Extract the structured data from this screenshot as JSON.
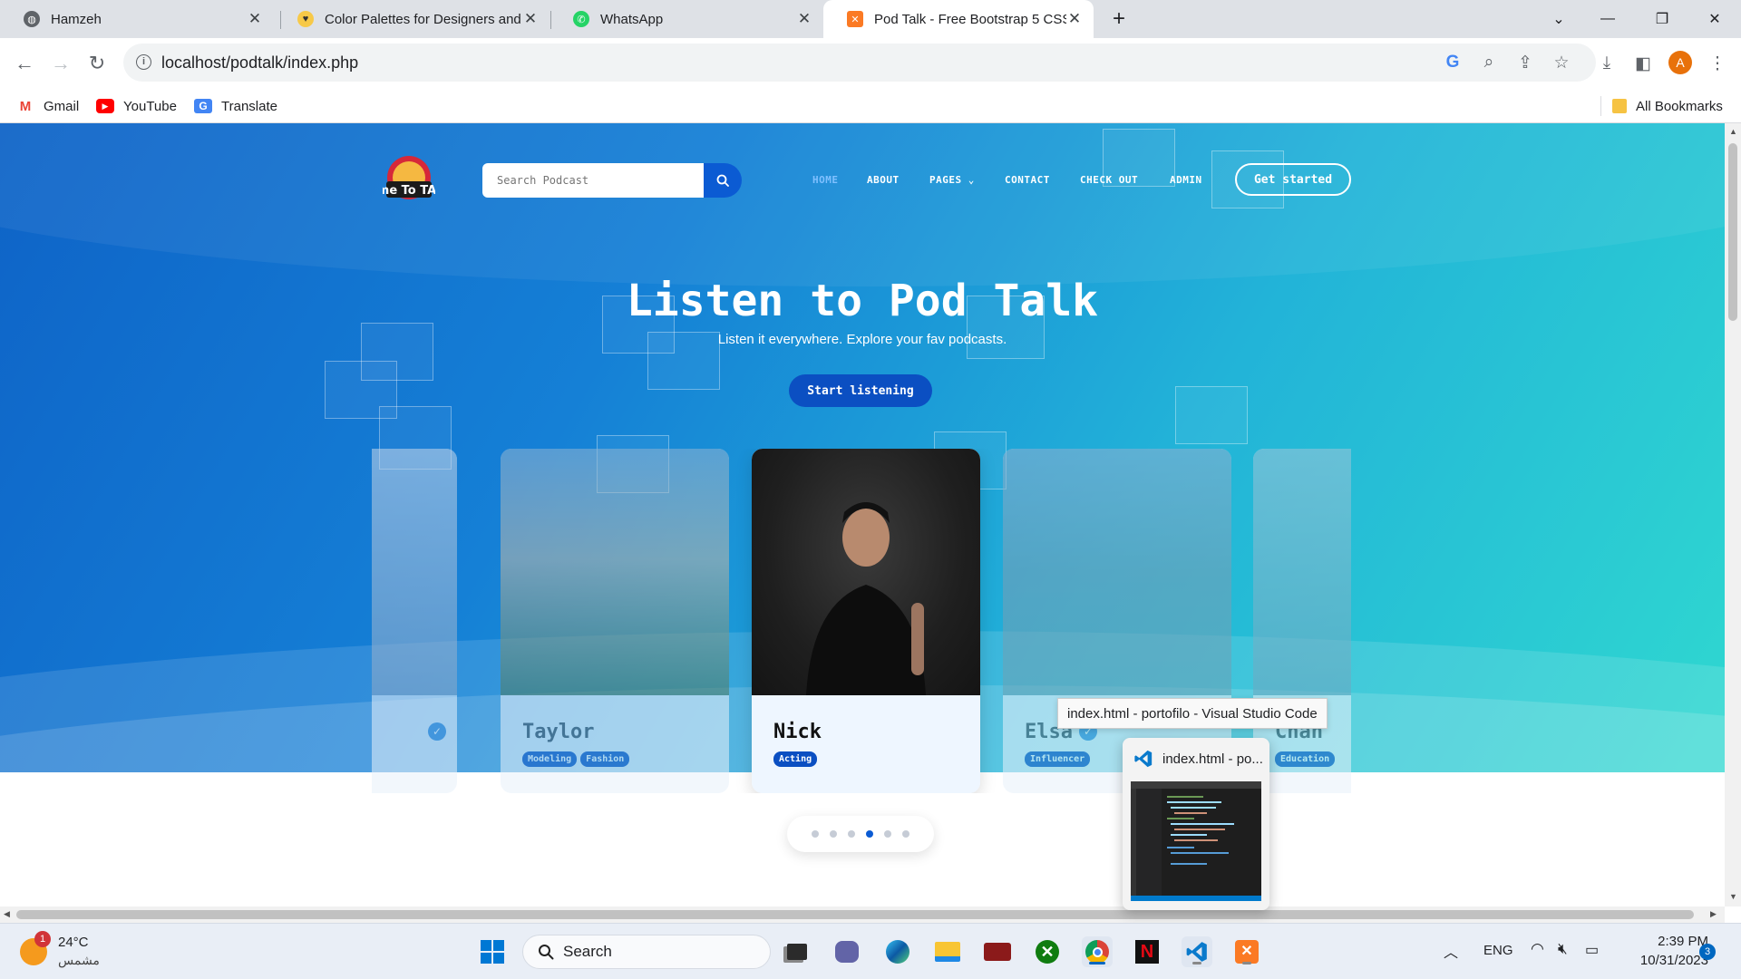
{
  "browser": {
    "tabs": [
      {
        "title": "Hamzeh",
        "icon": "globe-icon"
      },
      {
        "title": "Color Palettes for Designers and",
        "icon": "palette-app-icon"
      },
      {
        "title": "WhatsApp",
        "icon": "whatsapp-icon"
      },
      {
        "title": "Pod Talk - Free Bootstrap 5 CSS",
        "icon": "xampp-icon"
      }
    ],
    "new_tab": "+",
    "url": "localhost/podtalk/index.php",
    "profile_initial": "A",
    "bookmarks": [
      {
        "label": "Gmail",
        "icon": "gmail-icon"
      },
      {
        "label": "YouTube",
        "icon": "youtube-icon"
      },
      {
        "label": "Translate",
        "icon": "translate-icon"
      }
    ],
    "all_bookmarks": "All Bookmarks"
  },
  "site": {
    "search_placeholder": "Search Podcast",
    "nav": [
      "HOME",
      "ABOUT",
      "PAGES",
      "CONTACT",
      "CHECK OUT",
      "ADMIN"
    ],
    "active_nav": "HOME",
    "cta": "Get started",
    "logo_text": "Time To TALK",
    "hero_title": "Listen to Pod Talk",
    "hero_subtitle": "Listen it everywhere. Explore your fav podcasts.",
    "hero_button": "Start listening",
    "cards": [
      {
        "name": "",
        "tags": [],
        "faded": true
      },
      {
        "name": "Taylor",
        "tags": [
          "Modeling",
          "Fashion"
        ],
        "faded": true
      },
      {
        "name": "Nick",
        "tags": [
          "Acting"
        ],
        "faded": false
      },
      {
        "name": "Elsa",
        "tags": [
          "Influencer"
        ],
        "faded": true
      },
      {
        "name": "Chan",
        "tags": [
          "Education"
        ],
        "faded": true
      }
    ],
    "carousel_dots": 6,
    "active_dot": 3
  },
  "overlay": {
    "tooltip": "index.html - portofilo - Visual Studio Code",
    "preview_title": "index.html - po..."
  },
  "taskbar": {
    "weather_temp": "24°C",
    "weather_desc": "مشمس",
    "weather_badge": "1",
    "search_label": "Search",
    "language": "ENG",
    "time": "2:39 PM",
    "date": "10/31/2023",
    "notification_count": "3"
  },
  "colors": {
    "accent": "#0b5bd3",
    "hero_start": "#0e63c7",
    "hero_end": "#2fd8d0"
  }
}
